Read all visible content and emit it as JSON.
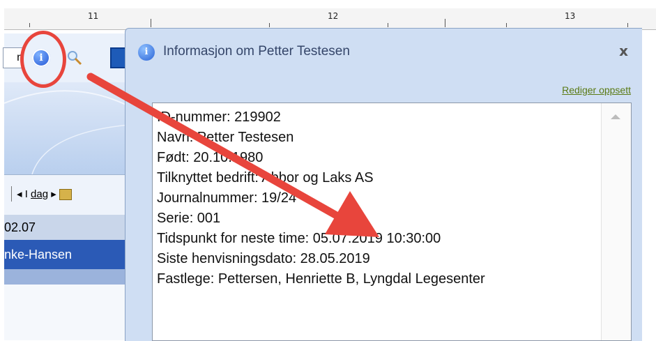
{
  "ruler": {
    "numbers": [
      "11",
      "12",
      "13"
    ]
  },
  "toolbar": {
    "cut_left_text": "n",
    "info_icon": "info-icon",
    "magnifier_icon": "search-icon"
  },
  "calendar": {
    "today_label_prefix": "I ",
    "today_label_underlined": "dag",
    "date_text": "02.07",
    "resource_name": "nke-Hansen"
  },
  "dialog": {
    "title": "Informasjon om Petter Testesen",
    "close_label": "x",
    "edit_link": "Rediger oppsett",
    "info_lines": [
      "ID-nummer: 219902",
      "Navn: Petter Testesen",
      "Født: 20.10.1980",
      "Tilknyttet bedrift: Abbor og Laks AS",
      "Journalnummer: 19/24",
      "Serie: 001",
      "Tidspunkt for neste time: 05.07.2019 10:30:00",
      "Siste henvisningsdato: 28.05.2019",
      "Fastlege: Pettersen, Henriette B, Lyngdal Legesenter"
    ]
  },
  "colors": {
    "highlight": "#e8453c",
    "dialog_bg": "#cfdef3",
    "link": "#5a7a14"
  }
}
